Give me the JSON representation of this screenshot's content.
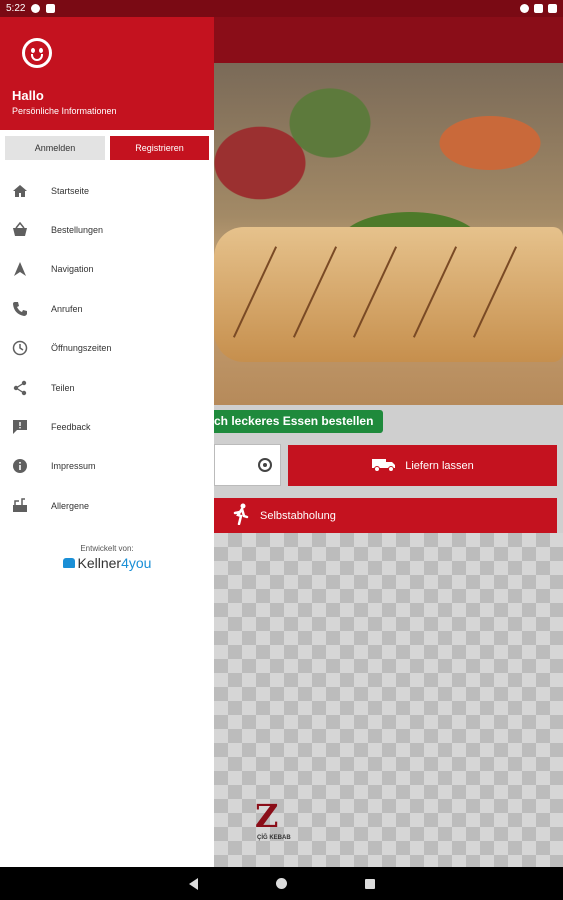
{
  "status": {
    "time": "5:22"
  },
  "drawer": {
    "greeting": "Hallo",
    "subtitle": "Persönliche Informationen",
    "login_label": "Anmelden",
    "register_label": "Registrieren",
    "items": [
      {
        "label": "Startseite",
        "icon": "home-icon"
      },
      {
        "label": "Bestellungen",
        "icon": "basket-icon"
      },
      {
        "label": "Navigation",
        "icon": "navigation-icon"
      },
      {
        "label": "Anrufen",
        "icon": "phone-icon"
      },
      {
        "label": "Öffnungszeiten",
        "icon": "clock-icon"
      },
      {
        "label": "Teilen",
        "icon": "share-icon"
      },
      {
        "label": "Feedback",
        "icon": "feedback-icon"
      },
      {
        "label": "Impressum",
        "icon": "info-icon"
      },
      {
        "label": "Allergene",
        "icon": "allergen-icon"
      }
    ],
    "developed_by": "Entwickelt von:",
    "brand_main": "Kellner",
    "brand_accent": "4you"
  },
  "app": {
    "tagline": "ch leckeres Essen bestellen",
    "deliver_label": "Liefern lassen",
    "pickup_label": "Selbstabholung",
    "logo_letter": "Z",
    "logo_text": "ÇİĞ KEBAB"
  },
  "colors": {
    "primary": "#c4121f",
    "dark": "#8a0d18",
    "accent_green": "#1f8a3c",
    "brand_blue": "#1a8fd6"
  }
}
